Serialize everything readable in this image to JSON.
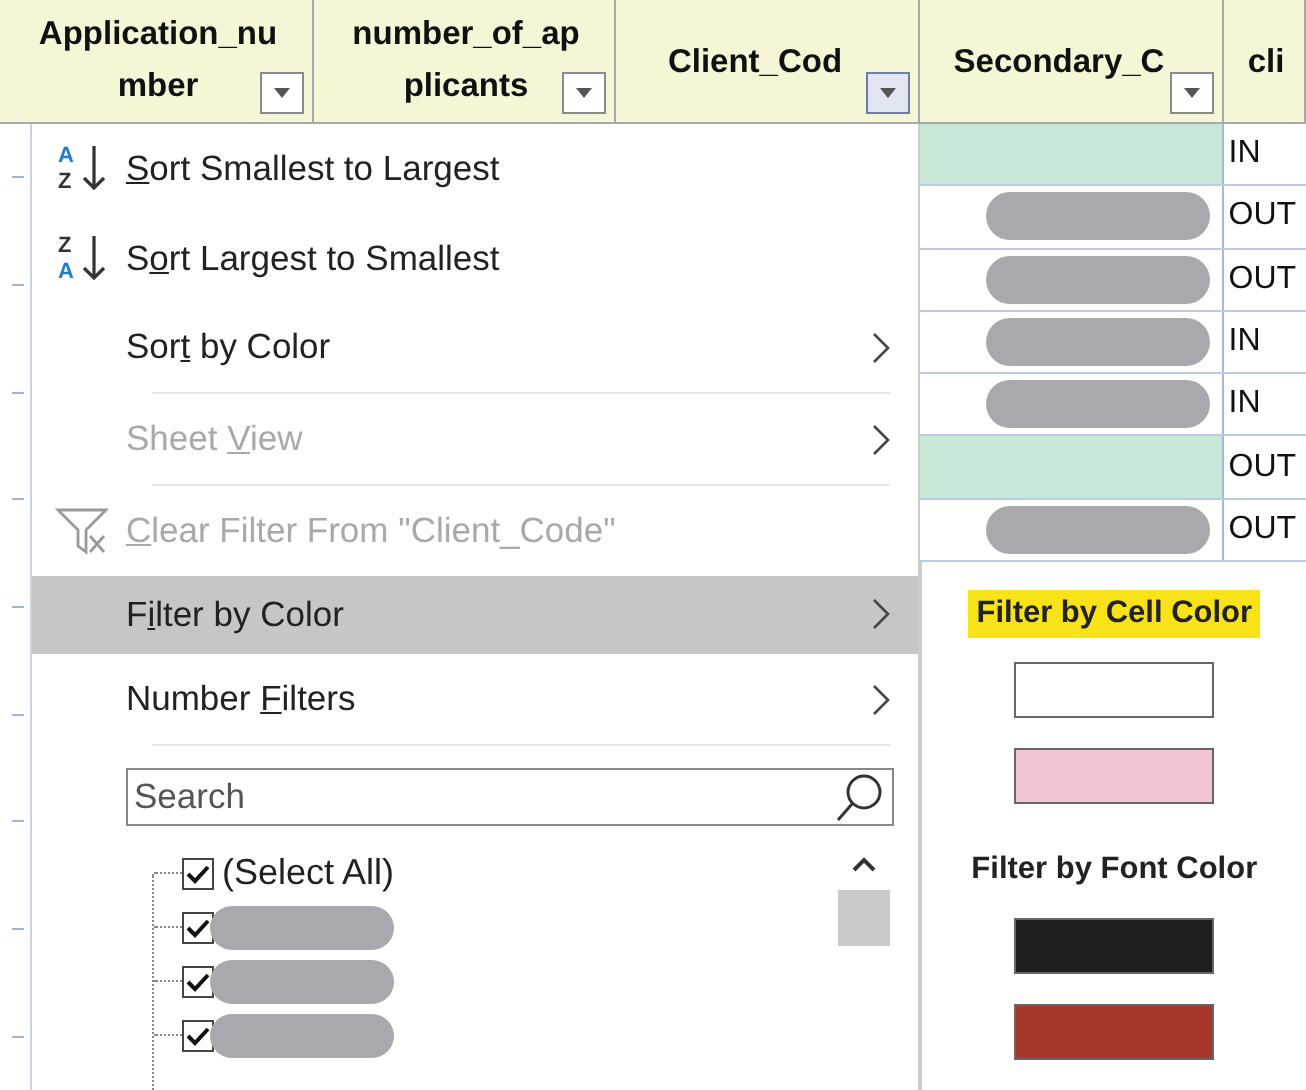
{
  "columns": [
    {
      "lines": [
        "Application_nu",
        "mber"
      ],
      "filter_active": false
    },
    {
      "lines": [
        "number_of_ap",
        "plicants"
      ],
      "filter_active": false
    },
    {
      "lines": [
        "Client_Cod"
      ],
      "filter_active": true
    },
    {
      "lines": [
        "Secondary_C"
      ],
      "filter_active": false
    },
    {
      "lines": [
        "cli"
      ]
    }
  ],
  "menu": {
    "items": [
      {
        "kind": "sort-ascending",
        "icon_letters": [
          "A",
          "Z"
        ],
        "label": {
          "key": "S",
          "after": "ort Smallest to Largest"
        },
        "disabled": false,
        "selected": false,
        "submenu": false
      },
      {
        "kind": "sort-descending",
        "icon_letters": [
          "Z",
          "A"
        ],
        "label": {
          "before": "S",
          "key": "o",
          "after": "rt Largest to Smallest"
        },
        "disabled": false,
        "selected": false,
        "submenu": false
      },
      {
        "kind": "plain",
        "label": {
          "before": "Sor",
          "key": "t",
          "after": " by Color"
        },
        "disabled": false,
        "selected": false,
        "submenu": true
      },
      {
        "kind": "separator"
      },
      {
        "kind": "plain",
        "label": {
          "before": "Sheet ",
          "key": "V",
          "after": "iew"
        },
        "disabled": true,
        "selected": false,
        "submenu": true
      },
      {
        "kind": "separator"
      },
      {
        "kind": "clear-filter",
        "label": {
          "key": "C",
          "after": "lear Filter From \"Client_Code\""
        },
        "disabled": true,
        "selected": false,
        "submenu": false
      },
      {
        "kind": "plain",
        "label": {
          "before": "F",
          "key": "i",
          "after": "lter by Color"
        },
        "disabled": false,
        "selected": true,
        "submenu": true
      },
      {
        "kind": "plain",
        "label": {
          "before": "Number ",
          "key": "F",
          "after": "ilters"
        },
        "disabled": false,
        "selected": false,
        "submenu": true
      },
      {
        "kind": "separator"
      }
    ],
    "search": {
      "placeholder": "Search"
    },
    "values": [
      {
        "label": "(Select All)",
        "checked": true
      },
      {
        "checked": true,
        "redacted": true
      },
      {
        "checked": true,
        "redacted": true
      },
      {
        "checked": true,
        "redacted": true
      }
    ]
  },
  "rows": [
    {
      "color": "#c9e7d7",
      "redacted": false,
      "direction": "IN"
    },
    {
      "color": "#ffffff",
      "redacted": true,
      "direction": "OUT"
    },
    {
      "color": "#ffffff",
      "redacted": true,
      "direction": "OUT"
    },
    {
      "color": "#ffffff",
      "redacted": true,
      "direction": "IN"
    },
    {
      "color": "#ffffff",
      "redacted": true,
      "direction": "IN"
    },
    {
      "color": "#c9e7d7",
      "redacted": false,
      "direction": "OUT"
    },
    {
      "color": "#ffffff",
      "redacted": true,
      "direction": "OUT"
    }
  ],
  "color_submenu": {
    "sections": [
      {
        "heading": "Filter by Cell Color",
        "highlighted": true,
        "swatches": [
          {
            "color": "#ffffff"
          },
          {
            "color": "#f2c5d3"
          }
        ]
      },
      {
        "heading": "Filter by Font Color",
        "highlighted": false,
        "swatches": [
          {
            "color": "#1f1f1f"
          },
          {
            "color": "#a8362a"
          }
        ]
      }
    ]
  }
}
